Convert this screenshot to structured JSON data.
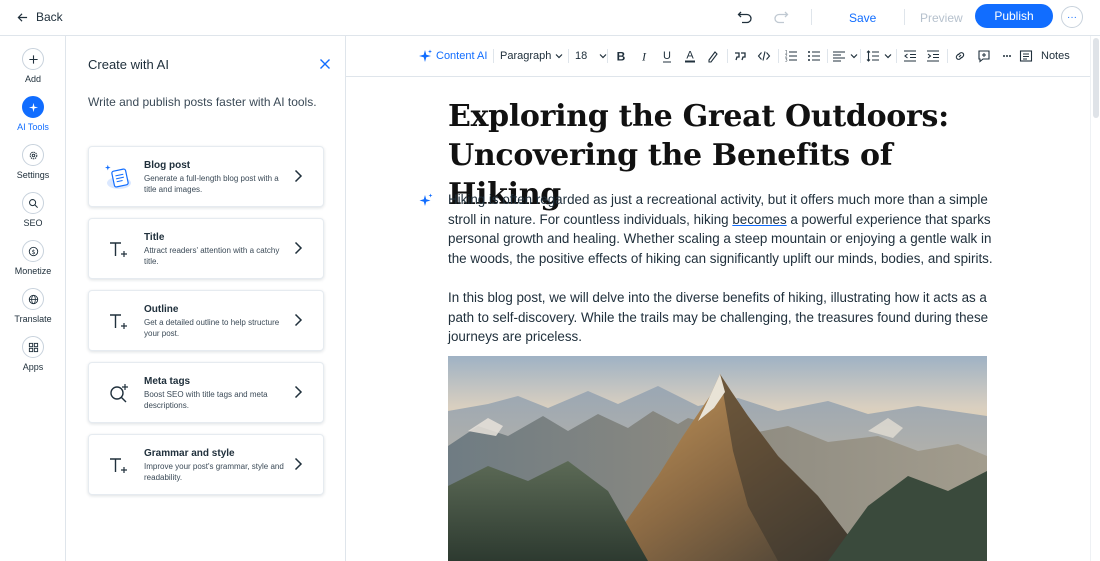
{
  "topbar": {
    "back_label": "Back",
    "save_label": "Save",
    "preview_label": "Preview",
    "publish_label": "Publish",
    "more_label": "···"
  },
  "rail": {
    "items": [
      {
        "label": "Add",
        "icon": "plus-icon"
      },
      {
        "label": "AI Tools",
        "icon": "sparkle-icon",
        "active": true
      },
      {
        "label": "Settings",
        "icon": "gear-icon"
      },
      {
        "label": "SEO",
        "icon": "search-icon"
      },
      {
        "label": "Monetize",
        "icon": "dollar-icon"
      },
      {
        "label": "Translate",
        "icon": "globe-icon"
      },
      {
        "label": "Apps",
        "icon": "apps-icon"
      }
    ]
  },
  "panel": {
    "title": "Create with AI",
    "subtitle": "Write and publish posts faster with AI tools.",
    "cards": [
      {
        "title": "Blog post",
        "desc": "Generate a full-length blog post with a title and images."
      },
      {
        "title": "Title",
        "desc": "Attract readers' attention with a catchy title."
      },
      {
        "title": "Outline",
        "desc": "Get a detailed outline to help structure your post."
      },
      {
        "title": "Meta tags",
        "desc": "Boost SEO with title tags and meta descriptions."
      },
      {
        "title": "Grammar and style",
        "desc": "Improve your post's grammar, style and readability."
      }
    ]
  },
  "toolbar": {
    "content_ai": "Content AI",
    "paragraph": "Paragraph",
    "font_size": "18",
    "notes": "Notes"
  },
  "post": {
    "title_line1": "Exploring the Great Outdoors:",
    "title_line2": "Uncovering the Benefits of Hiking",
    "p1_before": "Hiking is often regarded as just a recreational activity, but it offers much more than a simple stroll in nature. For countless individuals, hiking ",
    "p1_underlined": "becomes",
    "p1_after": " a powerful experience that sparks personal growth and healing. Whether scaling a steep mountain or enjoying a gentle walk in the woods, the positive effects of hiking can significantly uplift our minds, bodies, and spirits.",
    "p2": "In this blog post, we will delve into the diverse benefits of hiking, illustrating how it acts as a path to self-discovery. While the trails may be challenging, the treasures found during these journeys are priceless."
  },
  "colors": {
    "accent": "#116dff",
    "text": "#20303c",
    "border": "#dfe5eb"
  }
}
